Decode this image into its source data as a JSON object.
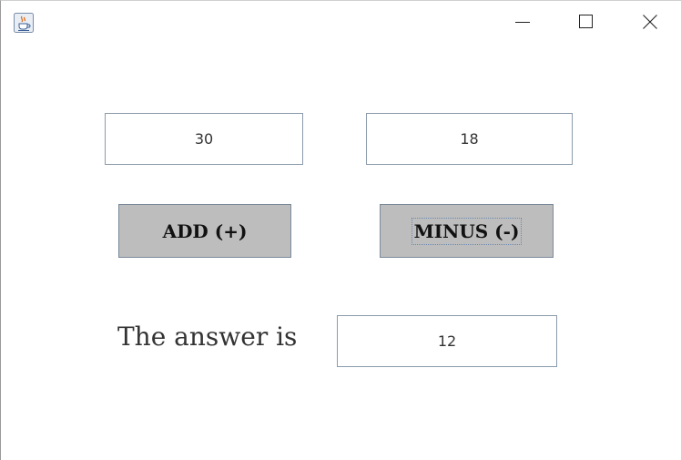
{
  "window": {
    "icon": "java-cup-icon",
    "controls": {
      "minimize": "minimize-icon",
      "maximize": "maximize-icon",
      "close": "close-icon"
    }
  },
  "inputs": {
    "first_value": "30",
    "second_value": "18"
  },
  "buttons": {
    "add_label": "ADD (+)",
    "minus_label": "MINUS (-)"
  },
  "result": {
    "label": "The answer is",
    "value": "12"
  },
  "colors": {
    "button_bg": "#bdbdbd",
    "field_border": "#8b9aab",
    "text": "#333333"
  }
}
